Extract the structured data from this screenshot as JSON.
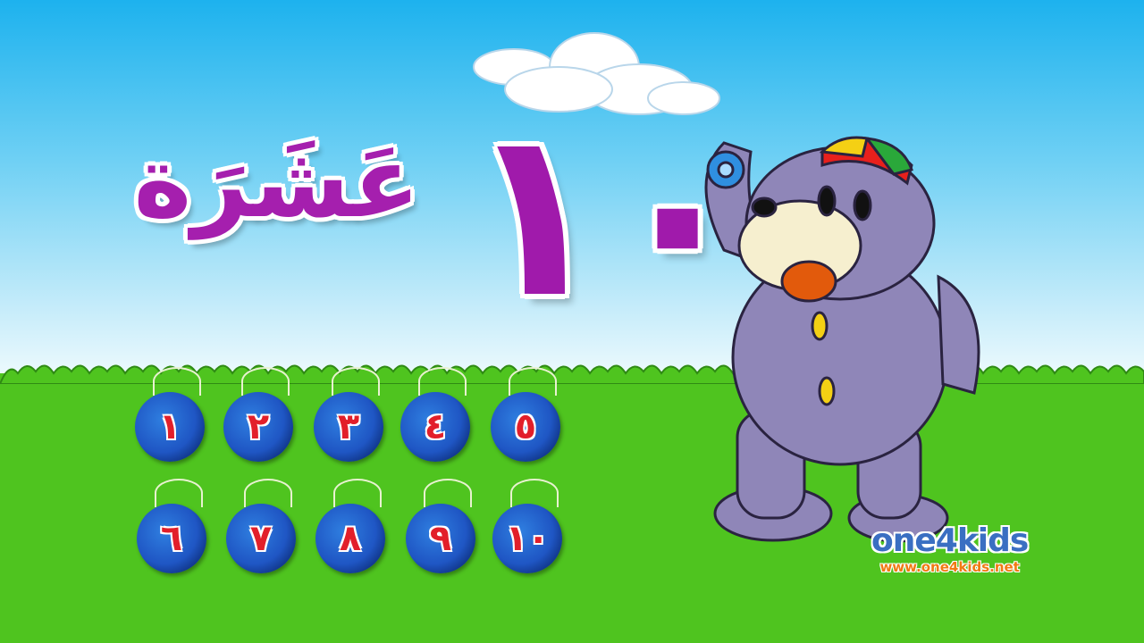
{
  "lesson": {
    "word": "عَشَرَة",
    "number": "١٠"
  },
  "yoyos": [
    "١",
    "٢",
    "٣",
    "٤",
    "٥",
    "٦",
    "٧",
    "٨",
    "٩",
    "١٠"
  ],
  "logo": {
    "brand": "one4kids",
    "url": "www.one4kids.net"
  },
  "colors": {
    "sky": "#1db2ee",
    "grass": "#4fc41f",
    "purple": "#a51fae",
    "yoyo": "#1f56c4",
    "digit": "#e21f2a"
  }
}
